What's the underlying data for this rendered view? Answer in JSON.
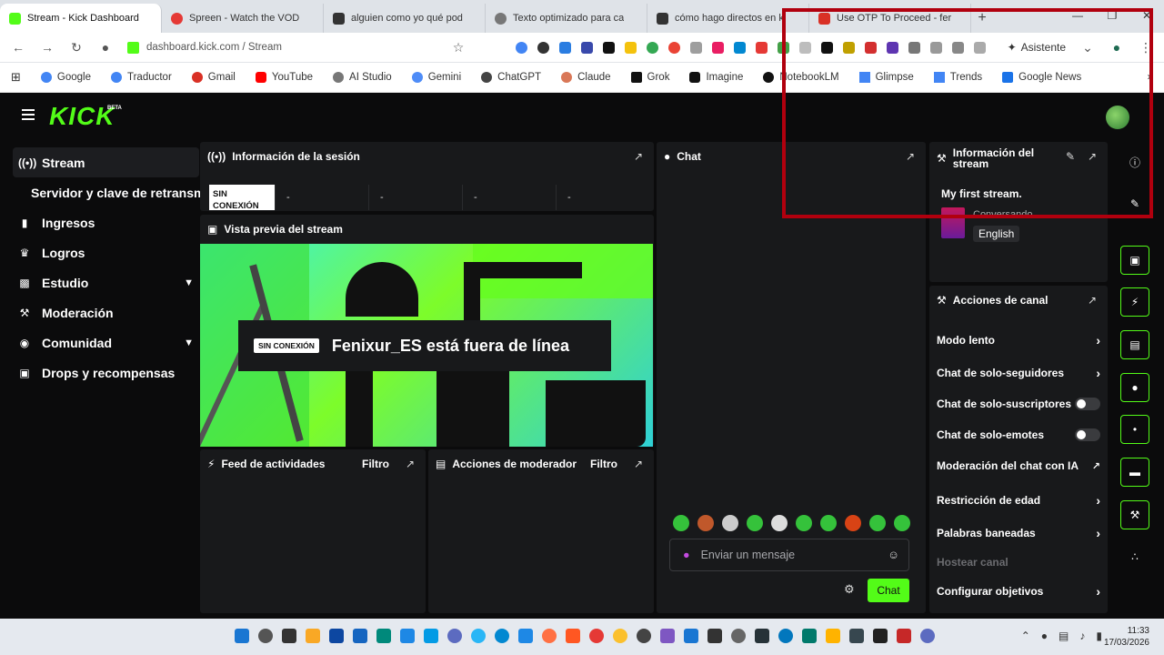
{
  "browser": {
    "tabs": [
      {
        "title": "Stream - Kick Dashboard",
        "color": "#53fc18",
        "active": true
      },
      {
        "title": "Spreen - Watch the VOD",
        "color": "#e53935"
      },
      {
        "title": "alguien como yo qué pod",
        "color": "#333333"
      },
      {
        "title": "Texto optimizado para ca",
        "color": "#555555"
      },
      {
        "title": "cómo hago directos en ki",
        "color": "#333333"
      },
      {
        "title": "Use OTP To Proceed - fer",
        "color": "#d93025"
      }
    ],
    "new_tab": "+",
    "url": "dashboard.kick.com / Stream",
    "assistant": "Asistente",
    "bookmarks": [
      "Google",
      "Traductor",
      "Gmail",
      "YouTube",
      "AI Studio",
      "Gemini",
      "ChatGPT",
      "Claude",
      "Grok",
      "Imagine",
      "NotebookLM",
      "Glimpse",
      "Trends",
      "Google News"
    ]
  },
  "kick": {
    "logo": "KICK",
    "beta": "BETA"
  },
  "sidebar": {
    "items": [
      {
        "label": "Stream",
        "icon": "broadcast-icon"
      },
      {
        "label": "Servidor y clave de retransm"
      },
      {
        "label": "Ingresos",
        "icon": "chart-icon"
      },
      {
        "label": "Logros",
        "icon": "trophy-icon"
      },
      {
        "label": "Estudio",
        "icon": "video-icon"
      },
      {
        "label": "Moderación",
        "icon": "wrench-icon"
      },
      {
        "label": "Comunidad",
        "icon": "people-icon"
      },
      {
        "label": "Drops y recompensas",
        "icon": "gift-icon"
      }
    ]
  },
  "session": {
    "title": "Información de la sesión",
    "status": "SIN CONEXIÓN",
    "values": [
      "-",
      "-",
      "-",
      "-"
    ]
  },
  "preview": {
    "title": "Vista previa del stream",
    "badge": "SIN CONEXIÓN",
    "message": "Fenixur_ES está fuera de línea"
  },
  "feed": {
    "title": "Feed de actividades",
    "filter": "Filtro"
  },
  "modactions": {
    "title": "Acciones de moderador",
    "filter": "Filtro"
  },
  "chat": {
    "title": "Chat",
    "placeholder": "Enviar un mensaje",
    "send": "Chat"
  },
  "streaminfo": {
    "title": "Información del stream",
    "stream_title": "My first stream.",
    "category": "Conversando",
    "language": "English"
  },
  "channel": {
    "title": "Acciones de canal",
    "actions": [
      {
        "label": "Modo lento",
        "kind": "arrow"
      },
      {
        "label": "Chat de solo-seguidores",
        "kind": "arrow"
      },
      {
        "label": "Chat de solo-suscriptores",
        "kind": "toggle"
      },
      {
        "label": "Chat de solo-emotes",
        "kind": "toggle"
      },
      {
        "label": "Moderación del chat con IA",
        "kind": "external"
      },
      {
        "label": "Restricción de edad",
        "kind": "arrow"
      },
      {
        "label": "Palabras baneadas",
        "kind": "arrow"
      },
      {
        "label": "Hostear canal",
        "kind": "disabled"
      },
      {
        "label": "Configurar objetivos",
        "kind": "arrow"
      }
    ]
  },
  "taskbar": {
    "time": "11:33",
    "date": "17/03/2026"
  }
}
